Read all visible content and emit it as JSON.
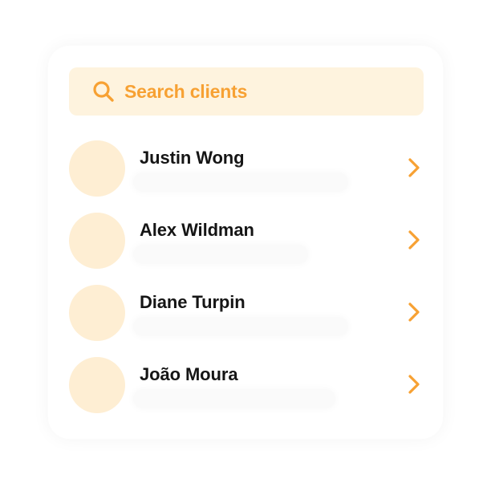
{
  "colors": {
    "accent": "#f7a133",
    "search_background": "#fef3de",
    "avatar_background": "#feeed3",
    "name_text": "#151515"
  },
  "search": {
    "placeholder": "Search clients",
    "icon": "search-icon"
  },
  "clients": [
    {
      "name": "Justin Wong",
      "icon": "chevron-right-icon"
    },
    {
      "name": "Alex Wildman",
      "icon": "chevron-right-icon"
    },
    {
      "name": "Diane Turpin",
      "icon": "chevron-right-icon"
    },
    {
      "name": "João Moura",
      "icon": "chevron-right-icon"
    }
  ]
}
